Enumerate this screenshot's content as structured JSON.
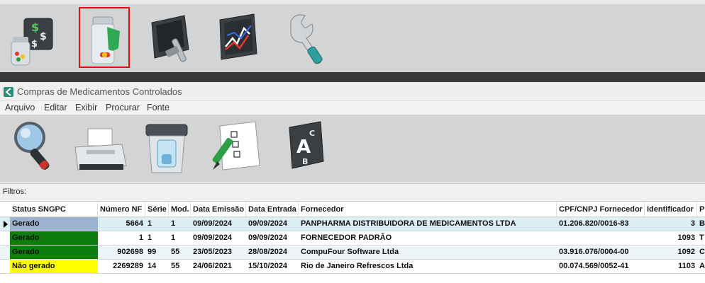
{
  "main_toolbar": {
    "buttons": [
      {
        "name": "financeiro",
        "icon": "money-jar-icon"
      },
      {
        "name": "medicamentos",
        "icon": "medicine-bottle-icon",
        "selected": true
      },
      {
        "name": "relatorio",
        "icon": "monitor-tool-icon"
      },
      {
        "name": "graficos",
        "icon": "chart-icon"
      },
      {
        "name": "configuracoes",
        "icon": "wrench-icon"
      }
    ]
  },
  "child_window": {
    "title": "Compras de Medicamentos Controlados",
    "icon": "app-logo-icon",
    "menu": [
      "Arquivo",
      "Editar",
      "Exibir",
      "Procurar",
      "Fonte"
    ],
    "toolbar": [
      {
        "icon": "magnifier-icon"
      },
      {
        "icon": "printer-icon"
      },
      {
        "icon": "trash-bin-icon"
      },
      {
        "icon": "checklist-icon"
      },
      {
        "icon": "sort-abc-icon"
      }
    ],
    "filters_label": "Filtros:"
  },
  "grid": {
    "columns": [
      "Status SNGPC",
      "Número NF",
      "Série",
      "Mod.",
      "Data Emissão",
      "Data Entrada",
      "Fornecedor",
      "CPF/CNPJ Fornecedor",
      "Identificador",
      "P"
    ],
    "rows": [
      {
        "status": "Gerado",
        "status_color": "#9cb3d0",
        "nf": "5664",
        "serie": "1",
        "mod": "1",
        "emissao": "09/09/2024",
        "entrada": "09/09/2024",
        "fornecedor": "PANPHARMA DISTRIBUIDORA DE MEDICAMENTOS LTDA",
        "cnpj": "01.206.820/0016-83",
        "ident": "3",
        "p": "B"
      },
      {
        "status": "Gerado",
        "status_color": "#0d7d0d",
        "nf": "1",
        "serie": "1",
        "mod": "1",
        "emissao": "09/09/2024",
        "entrada": "09/09/2024",
        "fornecedor": "FORNECEDOR PADRÃO",
        "cnpj": "",
        "ident": "1093",
        "p": "T"
      },
      {
        "status": "Gerado",
        "status_color": "#0d7d0d",
        "nf": "902698",
        "serie": "99",
        "mod": "55",
        "emissao": "23/05/2023",
        "entrada": "28/08/2024",
        "fornecedor": "CompuFour Software Ltda",
        "cnpj": "03.916.076/0004-00",
        "ident": "1092",
        "p": "C"
      },
      {
        "status": "Não gerado",
        "status_color": "#ffff00",
        "nf": "2269289",
        "serie": "14",
        "mod": "55",
        "emissao": "24/06/2021",
        "entrada": "15/10/2024",
        "fornecedor": "Rio de Janeiro Refrescos Ltda",
        "cnpj": "00.074.569/0052-41",
        "ident": "1103",
        "p": "A"
      }
    ]
  }
}
